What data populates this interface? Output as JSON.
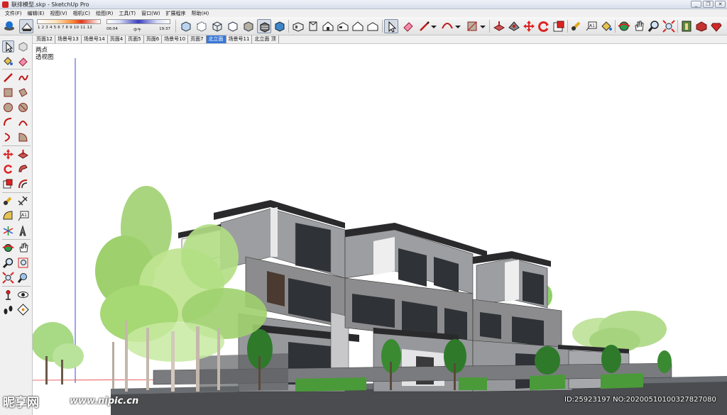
{
  "window": {
    "title": "联排模型.skp - SketchUp Pro",
    "minimize": "_",
    "restore": "❐",
    "close": "✕"
  },
  "menu": [
    "文件(F)",
    "编辑(E)",
    "视图(V)",
    "相机(C)",
    "绘图(R)",
    "工具(T)",
    "窗口(W)",
    "扩展程序",
    "帮助(H)"
  ],
  "shadow_settings": {
    "months": "1 2 3 4 5 6 7 8 9 10 11 12",
    "time_start": "06:04",
    "time_mid": "中午",
    "time_end": "19:37"
  },
  "scene_tabs": [
    {
      "label": "页面12",
      "active": false
    },
    {
      "label": "场景号13",
      "active": false
    },
    {
      "label": "场景号14",
      "active": false
    },
    {
      "label": "页面4",
      "active": false
    },
    {
      "label": "页面5",
      "active": false
    },
    {
      "label": "页面6",
      "active": false
    },
    {
      "label": "场景号10",
      "active": false
    },
    {
      "label": "页面7",
      "active": false
    },
    {
      "label": "北立面",
      "active": true
    },
    {
      "label": "场景号11",
      "active": false
    },
    {
      "label": "北立面 顶",
      "active": false
    },
    {
      "label": "",
      "active": false
    }
  ],
  "viewport": {
    "label_line1": "两点",
    "label_line2": "透视图"
  },
  "toolbar_icons": [
    "get-models-icon",
    "share-model-icon",
    "shadow-icon",
    "paint-icon",
    "eraser-icon",
    "line-icon",
    "arc-icon",
    "rectangle-icon",
    "push-pull-icon",
    "move-icon",
    "rotate-icon",
    "scale-icon",
    "tape-icon",
    "text-icon",
    "paint-bucket-icon",
    "orbit-icon",
    "pan-icon",
    "zoom-icon",
    "zoom-extents-icon",
    "warehouse-icon",
    "ruby-icon"
  ],
  "colors": {
    "sky": "#ffffff",
    "ground": "#4a4c4f",
    "tree_green": "#8ed060",
    "wall_gray": "#8c8c8e",
    "roof_dark": "#2a2a2c",
    "active_tab": "#3977d6"
  },
  "watermark": {
    "logo": "昵享网",
    "url": "www.nipic.cn",
    "id_text": "ID:25923197 NO:20200510100327827080"
  }
}
